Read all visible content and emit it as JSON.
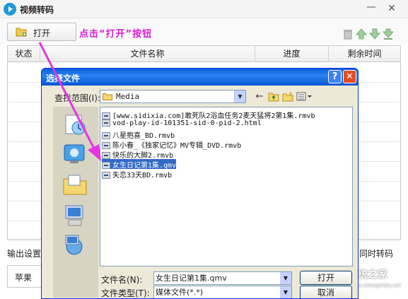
{
  "app": {
    "title": "视频转码"
  },
  "toolbar": {
    "open_label": "打开",
    "hint": "点击“打开”按钮"
  },
  "grid": {
    "columns": [
      "状态",
      "文件名称",
      "进度",
      "剩余时间"
    ],
    "row_count": 9
  },
  "bottom": {
    "output_settings_label": "输出设置",
    "simultaneous_label": "同时转码",
    "preset_value": "苹果"
  },
  "dialog": {
    "title": "选择文件",
    "look_in_label": "查找范围(I):",
    "look_in_value": "Media",
    "files": [
      "[www.sidixia.com]敢死队2浴血任务2麦天猛将2第1集.rmvb",
      "vod-play-id-101351-sid-0-pid-2.html",
      "八星抱喜_BD.rmvb",
      "陈小春_《独家记忆》MV专辑_DVD.rmvb",
      "快乐的大脚2.rmvb",
      "女生日记第1集.qmv",
      "失恋33天BD.rmvb"
    ],
    "selected_index": 5,
    "file_name_label": "文件名(N):",
    "file_name_value": "女生日记第1集.qmv",
    "file_type_label": "文件类型(T):",
    "file_type_value": "媒体文件(*.*)",
    "open_button": "打开",
    "cancel_button": "取消"
  },
  "watermark": {
    "text": "系统之家",
    "url": "www.xitongzhijia.net"
  },
  "colors": {
    "hint": "#d91cd2",
    "dialog_title": "#0a5ddb",
    "selection": "#316ac5"
  }
}
